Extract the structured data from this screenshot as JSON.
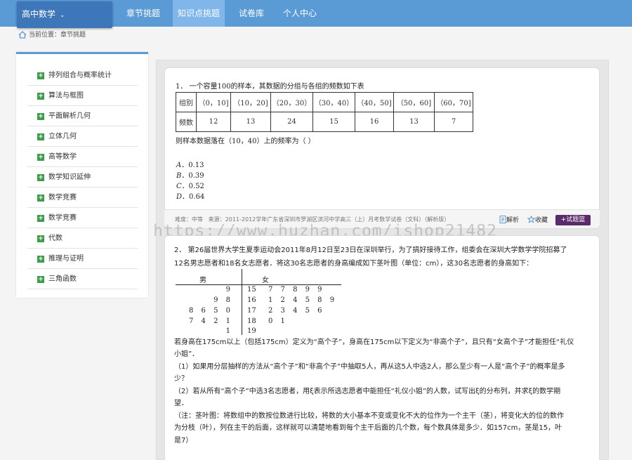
{
  "header": {
    "subject": "高中数学",
    "nav": [
      "章节挑题",
      "知识点挑题",
      "试卷库",
      "个人中心"
    ],
    "active_nav": "知识点挑题"
  },
  "breadcrumb": {
    "label": "当前位置：",
    "current": "章节挑题"
  },
  "sidebar": {
    "items": [
      "排列组合与概率统计",
      "算法与框图",
      "平面解析几何",
      "立体几何",
      "高等数学",
      "数学知识延伸",
      "数学竞赛",
      "数学竞赛",
      "代数",
      "推理与证明",
      "三角函数"
    ]
  },
  "question1": {
    "stem": "1． 一个容量100的样本，其数据的分组与各组的频数如下表",
    "table": {
      "row_labels": [
        "组别",
        "频数"
      ],
      "groups": [
        "（0，10]",
        "（10，20]",
        "（20，30）",
        "（30，40）",
        "（40，50]",
        "（50，60]",
        "（60，70]"
      ],
      "counts": [
        "12",
        "13",
        "24",
        "15",
        "16",
        "13",
        "7"
      ]
    },
    "prompt": "则样本数据落在（10，40）上的频率为（  ）",
    "options": [
      {
        "letter": "A",
        "text": "．0.13"
      },
      {
        "letter": "B",
        "text": "．0.39"
      },
      {
        "letter": "C",
        "text": "．0.52"
      },
      {
        "letter": "D",
        "text": "．0.64"
      }
    ],
    "footer": {
      "difficulty": "难度：中等",
      "source": "来源：2011-2012学年广东省深圳市罗湖区滨河中学高三（上）月考数学试卷（文科）（解析版）",
      "analysis": "解析",
      "favorite": "收藏",
      "add": "试题篮"
    }
  },
  "watermark": "https://www.huzhan.com/ishop21482",
  "question2": {
    "stem_line1": "2． 第26届世界大学生夏季运动会2011年8月12日至23日在深圳举行，为了搞好接待工作，组委会在深圳大学数学学院招募了",
    "stem_line2": "12名男志愿者和18名女志愿者．将这30名志愿者的身高编成如下茎叶图（单位：cm），这30名志愿者的身高如下：",
    "stem_leaf": {
      "male_label": "男",
      "female_label": "女",
      "rows": [
        {
          "male": "9",
          "stem": "15",
          "female": "7 7 8 9 9"
        },
        {
          "male": "9 8",
          "stem": "16",
          "female": "1 2 4 5 8 9"
        },
        {
          "male": "8 6 5 0",
          "stem": "17",
          "female": "2 3 4 5 6"
        },
        {
          "male": "7 4 2 1",
          "stem": "18",
          "female": "0 1"
        },
        {
          "male": "1",
          "stem": "19",
          "female": ""
        }
      ]
    },
    "lines": [
      "若身高在175cm以上（包括175cm）定义为“高个子”，身高在175cm以下定义为“非高个子”，且只有“女高个子”才能担任“礼仪",
      "小姐”．",
      "（1）如果用分层抽样的方法从“高个子”和“非高个子”中抽取5人，再从这5人中选2人，那么至少有一人是“高个子”的概率是多",
      "少？",
      "（2）若从所有“高个子”中选3名志愿者，用ξ表示所选志愿者中能担任“礼仪小姐”的人数，试写出ξ的分布列，并求ξ的数学期",
      "望．",
      "（注：茎叶图：将数组中的数按位数进行比较，将数的大小基本不变或变化不大的位作为一个主干（茎），将变化大的位的数作",
      "为分枝（叶），列在主干的后面，这样就可以清楚地看到每个主干后面的几个数，每个数具体是多少．如157cm，茎是15，叶",
      "是7）"
    ]
  },
  "colors": {
    "topbar": "#5b9bd5",
    "subject_bg": "#3e77b9",
    "active_tab": "#80b6ea",
    "plus_icon": "#3e9c4a",
    "add_button": "#5b2a6b"
  }
}
